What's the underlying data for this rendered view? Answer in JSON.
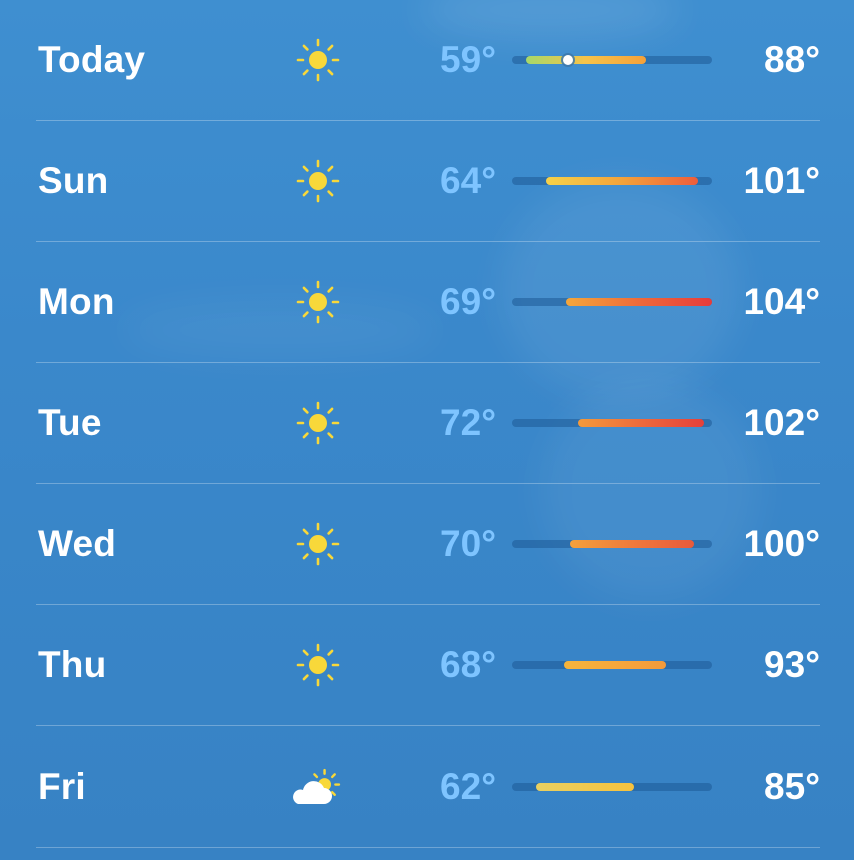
{
  "forecast": {
    "days": [
      {
        "day": "Today",
        "icon": "sun-icon",
        "low": "59°",
        "high": "88°",
        "bar_start": 0.07,
        "bar_end": 0.67,
        "current_marker": 0.28,
        "colors": [
          "#a6d86a",
          "#f7c34a",
          "#f5a13a"
        ]
      },
      {
        "day": "Sun",
        "icon": "sun-icon",
        "low": "64°",
        "high": "101°",
        "bar_start": 0.17,
        "bar_end": 0.93,
        "colors": [
          "#f6d24a",
          "#f3a33b",
          "#ee5d3b"
        ]
      },
      {
        "day": "Mon",
        "icon": "sun-icon",
        "low": "69°",
        "high": "104°",
        "bar_start": 0.27,
        "bar_end": 1.0,
        "colors": [
          "#f4a73b",
          "#ef6a3a",
          "#e63b3b"
        ]
      },
      {
        "day": "Tue",
        "icon": "sun-icon",
        "low": "72°",
        "high": "102°",
        "bar_start": 0.33,
        "bar_end": 0.96,
        "colors": [
          "#f39a3b",
          "#ee6a3b",
          "#e5403b"
        ]
      },
      {
        "day": "Wed",
        "icon": "sun-icon",
        "low": "70°",
        "high": "100°",
        "bar_start": 0.29,
        "bar_end": 0.91,
        "colors": [
          "#f4a13b",
          "#ef7a3b",
          "#e95a3b"
        ]
      },
      {
        "day": "Thu",
        "icon": "sun-icon",
        "low": "68°",
        "high": "93°",
        "bar_start": 0.26,
        "bar_end": 0.77,
        "colors": [
          "#f5b53d",
          "#f39a3b"
        ]
      },
      {
        "day": "Fri",
        "icon": "partly-cloudy-icon",
        "low": "62°",
        "high": "85°",
        "bar_start": 0.12,
        "bar_end": 0.61,
        "colors": [
          "#e9d062",
          "#f6c23e"
        ]
      }
    ]
  },
  "colors": {
    "background": "#3a88cb",
    "low_temp": "#7ec4ff",
    "sun": "#f8d83a"
  }
}
